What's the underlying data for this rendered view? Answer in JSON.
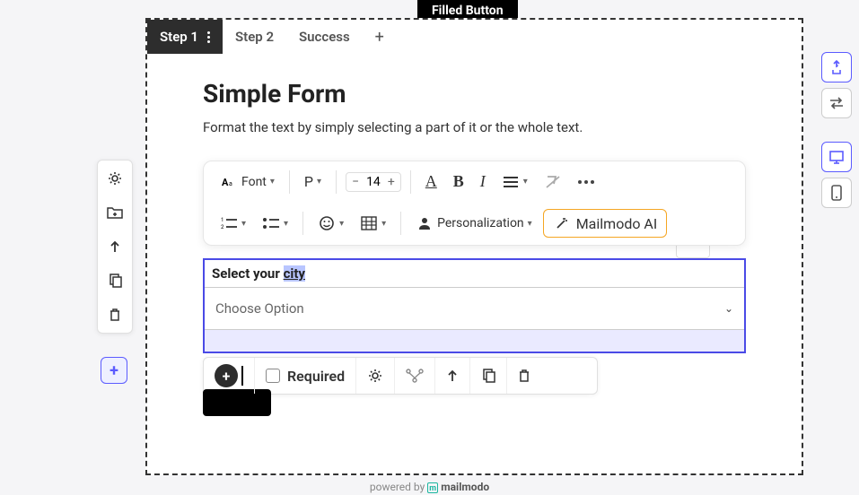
{
  "top_button": "Filled Button",
  "tabs": [
    "Step 1",
    "Step 2",
    "Success"
  ],
  "header": {
    "title": "Simple Form",
    "subtitle": "Format the text by simply selecting a part of it or the whole text."
  },
  "toolbar": {
    "font_label": "Font",
    "paragraph": "P",
    "size": "14",
    "personalization": "Personalization",
    "ai": "Mailmodo AI"
  },
  "field": {
    "label_prefix": "Select your ",
    "label_selected": "city",
    "placeholder": "Choose Option"
  },
  "actions": {
    "required": "Required"
  },
  "footer": {
    "prefix": "powered by ",
    "brand": "mailmodo"
  }
}
